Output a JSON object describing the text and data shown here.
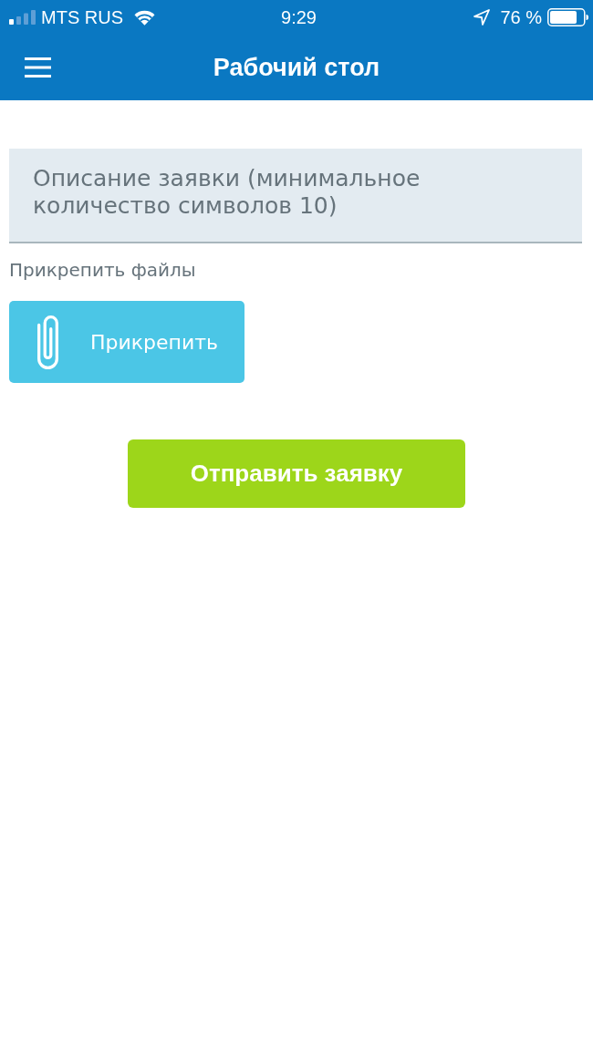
{
  "status_bar": {
    "carrier": "MTS RUS",
    "time": "9:29",
    "battery": "76 %"
  },
  "nav_bar": {
    "title": "Рабочий стол"
  },
  "form": {
    "description": {
      "placeholder": "Описание заявки (минимальное количество символов 10)"
    },
    "attach_label": "Прикрепить файлы",
    "attach_button": "Прикрепить",
    "submit_button": "Отправить заявку"
  }
}
